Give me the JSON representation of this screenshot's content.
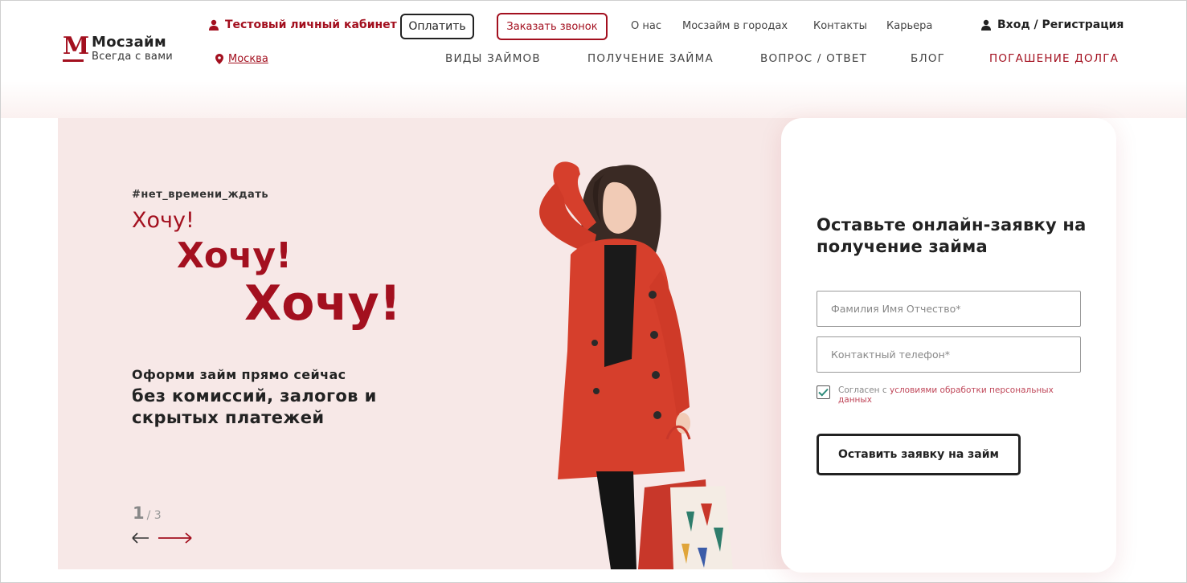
{
  "brand": {
    "name": "Мосзайм",
    "tagline": "Всегда с вами",
    "logo_letter": "M",
    "accent": "#a3101f"
  },
  "header": {
    "cabinet": "Тестовый личный кабинет",
    "city": "Москва",
    "pay_button": "Оплатить",
    "call_button": "Заказать звонок",
    "top_links": [
      "О нас",
      "Мосзайм в городах",
      "Контакты",
      "Карьера"
    ],
    "login": "Вход / Регистрация",
    "main_nav": [
      "ВИДЫ ЗАЙМОВ",
      "ПОЛУЧЕНИЕ ЗАЙМА",
      "ВОПРОС / ОТВЕТ",
      "БЛОГ",
      "ПОГАШЕНИЕ ДОЛГА"
    ]
  },
  "hero": {
    "hashtag": "#нет_времени_ждать",
    "want_1": "Хочу!",
    "want_2": "Хочу!",
    "want_3": "Хочу!",
    "offer_line1": "Оформи займ прямо сейчас",
    "offer_line2": "без комиссий, залогов и скрытых платежей",
    "slide_current": "1",
    "slide_total": "/ 3",
    "background": "#f7e8e7"
  },
  "form": {
    "title": "Оставьте онлайн-заявку на получение займа",
    "name_placeholder": "Фамилия Имя Отчество*",
    "phone_placeholder": "Контактный телефон*",
    "consent_prefix": "Согласен с",
    "consent_link": "условиями обработки персональных данных",
    "consent_checked": true,
    "submit": "Оставить заявку на займ"
  },
  "icons": {
    "cabinet": "user-icon",
    "city": "map-pin-icon",
    "login": "user-icon",
    "prev": "arrow-left-icon",
    "next": "arrow-right-icon",
    "check": "check-icon"
  }
}
